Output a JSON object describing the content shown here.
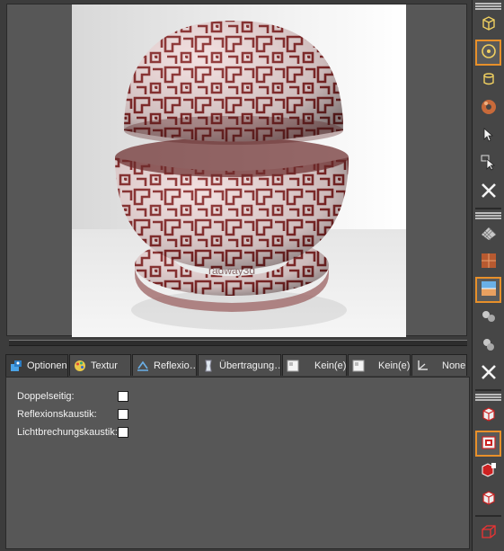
{
  "tabs": [
    {
      "label": "Optionen",
      "icon": "options-icon",
      "active": true
    },
    {
      "label": "Textur",
      "icon": "texture-palette-icon",
      "active": false
    },
    {
      "label": "Reflexio…",
      "icon": "reflection-icon",
      "active": false
    },
    {
      "label": "Übertragung…",
      "icon": "transmission-icon",
      "active": false
    },
    {
      "label": "Kein(e)",
      "icon": "map-slot-icon",
      "active": false
    },
    {
      "label": "Kein(e)",
      "icon": "map-slot-icon",
      "active": false
    },
    {
      "label": "None",
      "icon": "axes-icon",
      "active": false
    }
  ],
  "options": {
    "double_sided_label": "Doppelseitig:",
    "double_sided_checked": false,
    "reflection_caustic_label": "Reflexionskaustik:",
    "reflection_caustic_checked": false,
    "refraction_caustic_label": "Lichtbrechungskaustik:",
    "refraction_caustic_checked": false
  },
  "preview": {
    "watermark": "radway3d"
  },
  "colors": {
    "accent_selected": "#e8902a",
    "pattern": "#8a2a2a"
  }
}
